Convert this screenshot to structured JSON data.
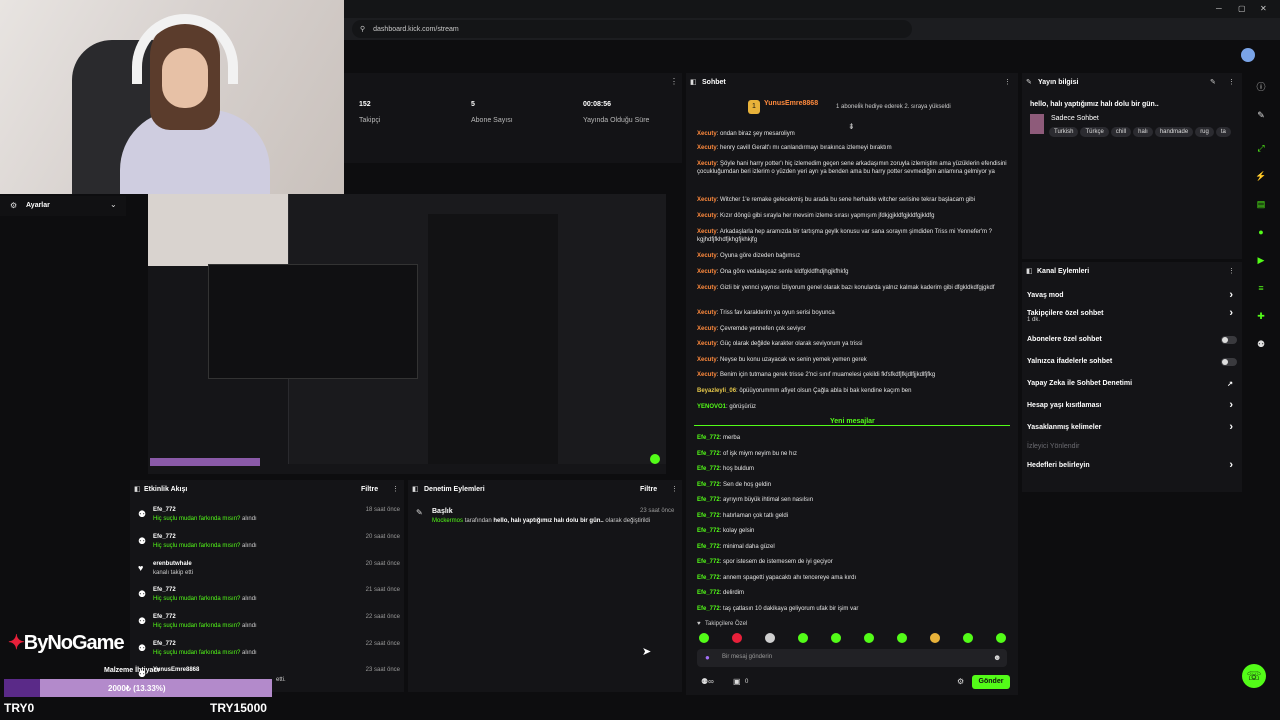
{
  "browser": {
    "url": "dashboard.kick.com/stream"
  },
  "settings": {
    "title": "Ayarlar"
  },
  "stats": [
    {
      "value": "152",
      "label": "Takipçi"
    },
    {
      "value": "5",
      "label": "Abone Sayısı"
    },
    {
      "value": "00:08:56",
      "label": "Yayında Olduğu Süre"
    }
  ],
  "chat": {
    "title": "Sohbet",
    "gift_user": "YunusEmre8868",
    "gift_text": "1 aboneli̇k hediye ederek 2. sıraya yükseldi",
    "messages_old": [
      {
        "u": "Xecuty",
        "t": "ondan biraz şey mesaroliym"
      },
      {
        "u": "Xecuty",
        "t": "henry cavill Geralt'ı mı canlandırmayı bırakınca izlemeyi bıraktım"
      },
      {
        "u": "Xecuty",
        "t": "Şöyle hani harry potter'ı hiç izlemedim geçen sene arkadaşımın zoruyla izlemiştim ama yüzüklerin efendisini çocukluğumdan beri izlerim o yüzden yeri ayrı ya benden ama bu harry potter sevmediğim anlamına gelmiyor ya"
      },
      {
        "u": "Xecuty",
        "t": "Witcher 1'e remake gelecekmiş bu arada bu sene herhalde witcher serisine tekrar başlacam gibi"
      },
      {
        "u": "Xecuty",
        "t": "Kızır döngü gibi sırayla her mevsim izleme sırası yapmışım jfdkjgjkldfgjkldfgjkldfg"
      },
      {
        "u": "Xecuty",
        "t": "Arkadaşlarla hep aramızda bir tartışma geylk konusu var sana sorayım şimdiden Triss mi Yennefer'm ? kgjhdfjfkhdfjkhgfjkhkjfg"
      },
      {
        "u": "Xecuty",
        "t": "Oyuna göre dizeden bağımsız"
      },
      {
        "u": "Xecuty",
        "t": "Ona göre vedalaşcaz senle kldfgkldfhdjhgjkfhkfg"
      },
      {
        "u": "Xecuty",
        "t": "Gizli bir yennci yaynısı İzliyorum genel olarak bazı konularda yalnız kalmak kaderim gibi dfgkldkdfgjgkdf"
      },
      {
        "u": "Xecuty",
        "t": "Triss fav karakterim ya oyun serisi boyunca"
      },
      {
        "u": "Xecuty",
        "t": "Çevremde yennefen çok seviyor"
      },
      {
        "u": "Xecuty",
        "t": "Güç olarak değilde karakter olarak seviyorum ya trissi"
      },
      {
        "u": "Xecuty",
        "t": "Neyse bu konu uzayacak ve senin yemek yemen gerek"
      },
      {
        "u": "Xecuty",
        "t": "Benim için tutmana gerek trisse 2'nci sınıf muamelesi çekildi fkfsfkdfjfkjdlfjjkdlfjfkg"
      },
      {
        "u": "Beyazleyli_06",
        "t": "öpüüyorummm afiyet olsun Çağla abla bi bak kendine kaçım ben"
      },
      {
        "u": "YENOVO1",
        "t": "görüşürüz"
      }
    ],
    "new_messages_label": "Yeni mesajlar",
    "messages_new": [
      {
        "u": "Efe_772",
        "t": "merba"
      },
      {
        "u": "Efe_772",
        "t": "of işk miym neyim bu ne hız"
      },
      {
        "u": "Efe_772",
        "t": "hoş buldum"
      },
      {
        "u": "Efe_772",
        "t": "Sen de hoş geldin"
      },
      {
        "u": "Efe_772",
        "t": "ayrıyım büyük ihtimal sen nasılsın"
      },
      {
        "u": "Efe_772",
        "t": "hatırlaman çok tatlı geldi"
      },
      {
        "u": "Efe_772",
        "t": "kolay gelsin"
      },
      {
        "u": "Efe_772",
        "t": "minimal daha güzel"
      },
      {
        "u": "Efe_772",
        "t": "spor istesem de istemesem de iyi geçiyor"
      },
      {
        "u": "Efe_772",
        "t": "annem spagetti yapacaktı ahı tencereye ama kırdı"
      },
      {
        "u": "Efe_772",
        "t": "delirdim"
      },
      {
        "u": "Efe_772",
        "t": "taş çatlasın 10 dakikaya geliyorum ufak bir işim var"
      }
    ],
    "followers_only": "Takipçilere Özel",
    "input_placeholder": "Bir mesaj gönderin",
    "count": "0",
    "send_label": "Gönder"
  },
  "stream_info": {
    "title": "Yayın bilgisi",
    "stream_title": "hello, halı yaptığımız halı dolu bir gün..",
    "category": "Sadece Sohbet",
    "tags": [
      "Turkish",
      "Türkçe",
      "chill",
      "halı",
      "handmade",
      "rug",
      "ta"
    ]
  },
  "channel_actions": {
    "title": "Kanal Eylemleri",
    "items": [
      {
        "label": "Yavaş mod",
        "sub": "",
        "control": "chevron"
      },
      {
        "label": "Takipçilere özel sohbet",
        "sub": "1 dk.",
        "control": "chevron"
      },
      {
        "label": "Abonelere özel sohbet",
        "sub": "",
        "control": "toggle"
      },
      {
        "label": "Yalnızca ifadelerle sohbet",
        "sub": "",
        "control": "toggle"
      },
      {
        "label": "Yapay Zeka ile Sohbet Denetimi",
        "sub": "",
        "control": "external"
      },
      {
        "label": "Hesap yaşı kısıtlaması",
        "sub": "",
        "control": "chevron"
      },
      {
        "label": "Yasaklanmış kelimeler",
        "sub": "",
        "control": "chevron"
      },
      {
        "label": "İzleyici Yönlendir",
        "sub": "",
        "control": "none"
      },
      {
        "label": "Hedefleri belirleyin",
        "sub": "",
        "control": "chevron"
      }
    ]
  },
  "activity": {
    "title": "Etkinlik Akışı",
    "filter_label": "Filtre",
    "items": [
      {
        "name": "Efe_772",
        "desc": "Hiç suçlu mudan farkında mısın?",
        "suffix": "alındı",
        "time": "18 saat önce"
      },
      {
        "name": "Efe_772",
        "desc": "Hiç suçlu mudan farkında mısın?",
        "suffix": "alındı",
        "time": "20 saat önce"
      },
      {
        "name": "erenbutwhale",
        "desc": "kanalı takip etti",
        "suffix": "",
        "time": "20 saat önce"
      },
      {
        "name": "Efe_772",
        "desc": "Hiç suçlu mudan farkında mısın?",
        "suffix": "alındı",
        "time": "21 saat önce"
      },
      {
        "name": "Efe_772",
        "desc": "Hiç suçlu mudan farkında mısın?",
        "suffix": "alındı",
        "time": "22 saat önce"
      },
      {
        "name": "Efe_772",
        "desc": "Hiç suçlu mudan farkında mısın?",
        "suffix": "alındı",
        "time": "22 saat önce"
      },
      {
        "name": "YunusEmre8868",
        "desc": "",
        "suffix": "etti.",
        "time": "23 saat önce"
      }
    ]
  },
  "moderation": {
    "title": "Denetim Eylemleri",
    "filter_label": "Filtre",
    "item_title": "Başlık",
    "item_user": "Mockermos",
    "item_mid": "tarafından",
    "item_text": "hello, halı yaptığımız halı dolu bir gün..",
    "item_suffix": "olarak değiştirildi",
    "item_time": "23 saat önce"
  },
  "overlay": {
    "brand": "ByNoGame",
    "goal_label": "Malzeme İhtiyacı",
    "goal_progress_text": "2000₺ (13.33%)",
    "goal_fraction": 0.1333,
    "goal_min": "TRY0",
    "goal_max": "TRY15000"
  },
  "colors": {
    "accent": "#53fc18",
    "username_orange": "#ff8a3d"
  }
}
